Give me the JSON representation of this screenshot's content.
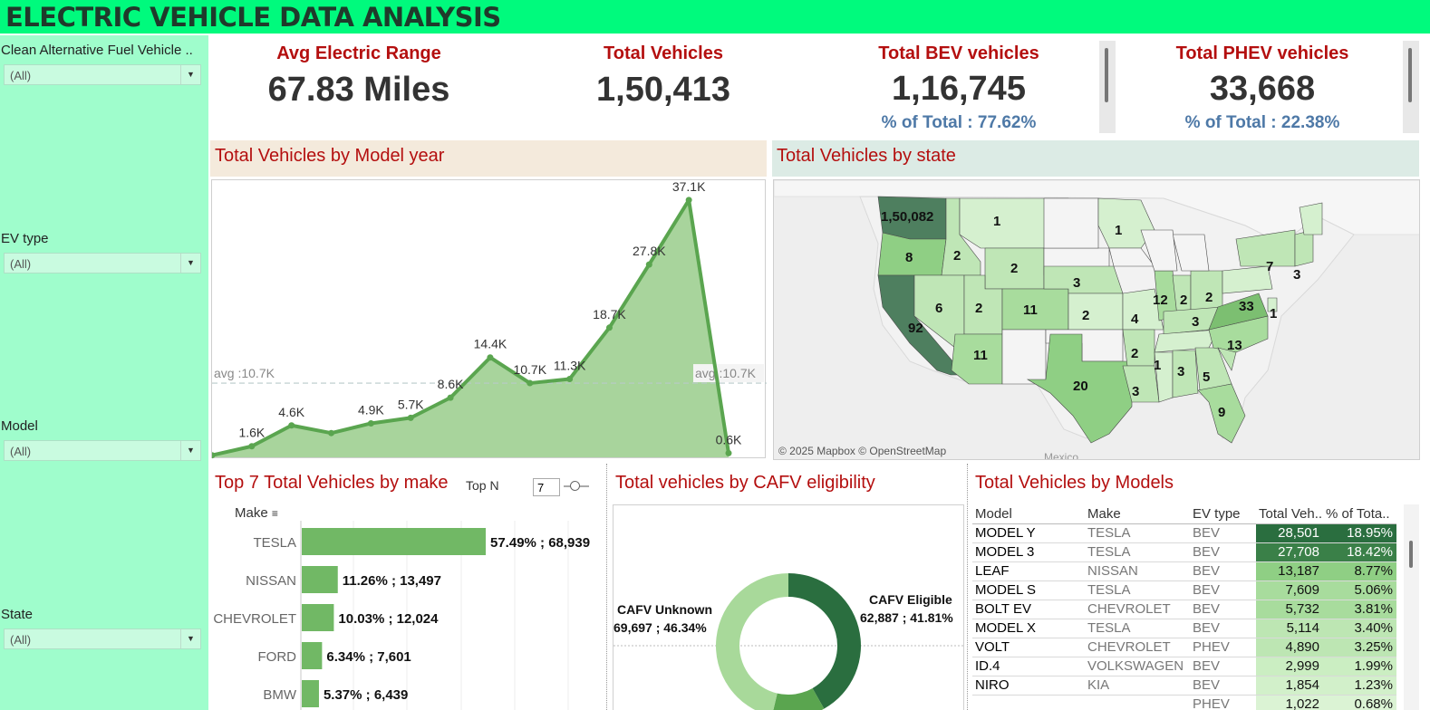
{
  "header": {
    "title": "ELECTRIC VEHICLE DATA ANALYSIS"
  },
  "filters": [
    {
      "label": "Clean Alternative Fuel Vehicle ..",
      "value": "(All)"
    },
    {
      "label": "EV type",
      "value": "(All)"
    },
    {
      "label": "Model",
      "value": "(All)"
    },
    {
      "label": "State",
      "value": "(All)"
    }
  ],
  "kpis": {
    "avg_range": {
      "title": "Avg Electric Range",
      "value": "67.83 Miles"
    },
    "total": {
      "title": "Total Vehicles",
      "value": "1,50,413"
    },
    "bev": {
      "title": "Total BEV vehicles",
      "value": "1,16,745",
      "sub": "% of Total : 77.62%"
    },
    "phev": {
      "title": "Total PHEV vehicles",
      "value": "33,668",
      "sub": "% of Total : 22.38%"
    }
  },
  "model_year": {
    "title": "Total Vehicles by Model year",
    "avg_label": "avg :10.7K",
    "colors": {
      "line": "#5aa54f",
      "area": "#a8d49c",
      "avg": "#b9c9c9"
    }
  },
  "state_map": {
    "title": "Total Vehicles by state",
    "attribution": "© 2025 Mapbox © OpenStreetMap",
    "country_label": "Mexico",
    "labels": [
      {
        "text": "1,50,082",
        "id": "WA"
      },
      {
        "text": "8",
        "id": "OR"
      },
      {
        "text": "92",
        "id": "CA"
      },
      {
        "text": "2",
        "id": "ID"
      },
      {
        "text": "1",
        "id": "MT"
      },
      {
        "text": "2",
        "id": "WY"
      },
      {
        "text": "6",
        "id": "NV"
      },
      {
        "text": "2",
        "id": "UT"
      },
      {
        "text": "11",
        "id": "CO"
      },
      {
        "text": "11",
        "id": "AZ"
      },
      {
        "text": "3",
        "id": "NE"
      },
      {
        "text": "2",
        "id": "KS"
      },
      {
        "text": "20",
        "id": "TX"
      },
      {
        "text": "1",
        "id": "MN"
      },
      {
        "text": "4",
        "id": "MO"
      },
      {
        "text": "2",
        "id": "AR"
      },
      {
        "text": "3",
        "id": "LA"
      },
      {
        "text": "12",
        "id": "IL"
      },
      {
        "text": "2",
        "id": "IN"
      },
      {
        "text": "2",
        "id": "OH"
      },
      {
        "text": "3",
        "id": "KY"
      },
      {
        "text": "1",
        "id": "MS"
      },
      {
        "text": "3",
        "id": "AL"
      },
      {
        "text": "5",
        "id": "GA"
      },
      {
        "text": "9",
        "id": "FL"
      },
      {
        "text": "13",
        "id": "NC"
      },
      {
        "text": "33",
        "id": "VA"
      },
      {
        "text": "1",
        "id": "DE"
      },
      {
        "text": "7",
        "id": "NY"
      },
      {
        "text": "3",
        "id": "MA"
      }
    ]
  },
  "make_chart": {
    "title": "Top 7 Total Vehicles by make",
    "topn_label": "Top N",
    "topn_value": "7",
    "axis_label": "Make",
    "bar_color": "#71b865"
  },
  "cafv": {
    "title": "Total vehicles by CAFV eligibility",
    "unknown_label": "CAFV Unknown",
    "unknown_value": "69,697 ; 46.34%",
    "eligible_label": "CAFV Eligible",
    "eligible_value": "62,887 ; 41.81%",
    "colors": {
      "eligible": "#2a6e3f",
      "unknown": "#a8d99a",
      "third": "#5aa54f"
    }
  },
  "models_table": {
    "title": "Total Vehicles by Models",
    "headers": [
      "Model",
      "Make",
      "EV type",
      "Total Veh..",
      "% of Tota.."
    ],
    "rows": [
      [
        "MODEL Y",
        "TESLA",
        "BEV",
        "28,501",
        "18.95%"
      ],
      [
        "MODEL 3",
        "TESLA",
        "BEV",
        "27,708",
        "18.42%"
      ],
      [
        "LEAF",
        "NISSAN",
        "BEV",
        "13,187",
        "8.77%"
      ],
      [
        "MODEL S",
        "TESLA",
        "BEV",
        "7,609",
        "5.06%"
      ],
      [
        "BOLT EV",
        "CHEVROLET",
        "BEV",
        "5,732",
        "3.81%"
      ],
      [
        "MODEL X",
        "TESLA",
        "BEV",
        "5,114",
        "3.40%"
      ],
      [
        "VOLT",
        "CHEVROLET",
        "PHEV",
        "4,890",
        "3.25%"
      ],
      [
        "ID.4",
        "VOLKSWAGEN",
        "BEV",
        "2,999",
        "1.99%"
      ],
      [
        "NIRO",
        "KIA",
        "BEV",
        "1,854",
        "1.23%"
      ],
      [
        "",
        "",
        "PHEV",
        "1,022",
        "0.68%"
      ]
    ]
  },
  "chart_data": [
    {
      "type": "area",
      "title": "Total Vehicles by Model year",
      "values": [
        0.3,
        1.6,
        4.6,
        3.5,
        4.9,
        5.7,
        8.6,
        14.4,
        10.7,
        11.3,
        18.7,
        27.8,
        37.1,
        0.6
      ],
      "labels": [
        "",
        "1.6K",
        "4.6K",
        "",
        "4.9K",
        "5.7K",
        "8.6K",
        "14.4K",
        "10.7K",
        "11.3K",
        "18.7K",
        "27.8K",
        "37.1K",
        "0.6K"
      ],
      "average": 10.7,
      "ylim": [
        0,
        38
      ]
    },
    {
      "type": "bar",
      "title": "Top 7 Total Vehicles by make",
      "categories": [
        "TESLA",
        "NISSAN",
        "CHEVROLET",
        "FORD",
        "BMW"
      ],
      "values": [
        68939,
        13497,
        12024,
        7601,
        6439
      ],
      "labels": [
        "57.49% ; 68,939",
        "11.26% ; 13,497",
        "10.03% ; 12,024",
        "6.34% ; 7,601",
        "5.37% ; 6,439"
      ]
    },
    {
      "type": "pie",
      "title": "Total vehicles by CAFV eligibility",
      "categories": [
        "CAFV Eligible",
        "CAFV Unknown",
        ""
      ],
      "values": [
        41.81,
        46.34,
        11.85
      ]
    }
  ]
}
